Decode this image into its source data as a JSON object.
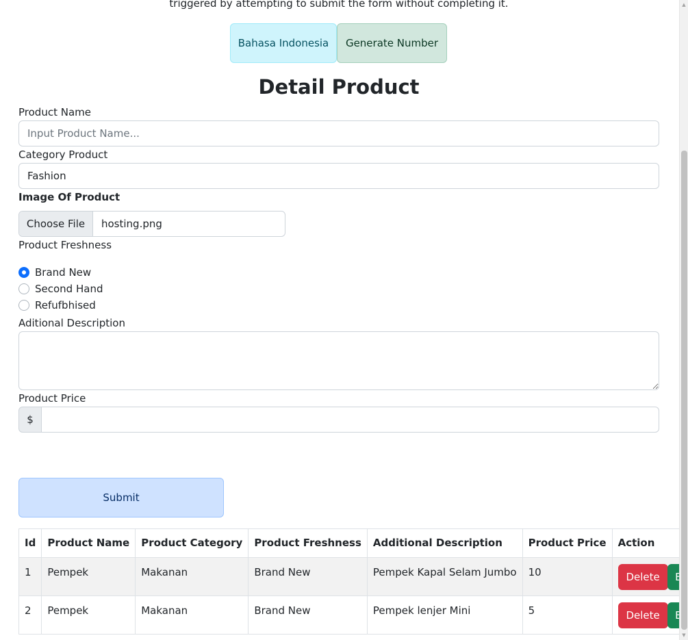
{
  "intro": {
    "text": "triggered by attempting to submit the form without completing it."
  },
  "header_buttons": {
    "language_label": "Bahasa Indonesia",
    "generate_label": "Generate Number"
  },
  "form": {
    "title": "Detail Product",
    "product_name": {
      "label": "Product Name",
      "placeholder": "Input Product Name...",
      "value": ""
    },
    "category": {
      "label": "Category Product",
      "selected": "Fashion"
    },
    "image": {
      "label": "Image Of Product",
      "button_label": "Choose File",
      "file_name": "hosting.png"
    },
    "freshness": {
      "label": "Product Freshness",
      "options": [
        {
          "label": "Brand New",
          "checked": true
        },
        {
          "label": "Second Hand",
          "checked": false
        },
        {
          "label": "Refufbhised",
          "checked": false
        }
      ]
    },
    "description": {
      "label": "Aditional Description",
      "value": ""
    },
    "price": {
      "label": "Product Price",
      "currency": "$",
      "value": ""
    },
    "submit_label": "Submit"
  },
  "table": {
    "headers": [
      "Id",
      "Product Name",
      "Product Category",
      "Product Freshness",
      "Additional Description",
      "Product Price",
      "Action"
    ],
    "rows": [
      {
        "id": "1",
        "name": "Pempek",
        "category": "Makanan",
        "freshness": "Brand New",
        "description": "Pempek Kapal Selam Jumbo",
        "price": "10"
      },
      {
        "id": "2",
        "name": "Pempek",
        "category": "Makanan",
        "freshness": "Brand New",
        "description": "Pempek lenjer Mini",
        "price": "5"
      }
    ],
    "delete_label": "Delete",
    "edit_label": "Edit"
  },
  "colors": {
    "info_bg": "#cff4fc",
    "success_bg": "#d1e7dd",
    "primary_bg": "#cfe2ff",
    "danger": "#dc3545",
    "success": "#198754",
    "radio_checked": "#0d6efd"
  }
}
